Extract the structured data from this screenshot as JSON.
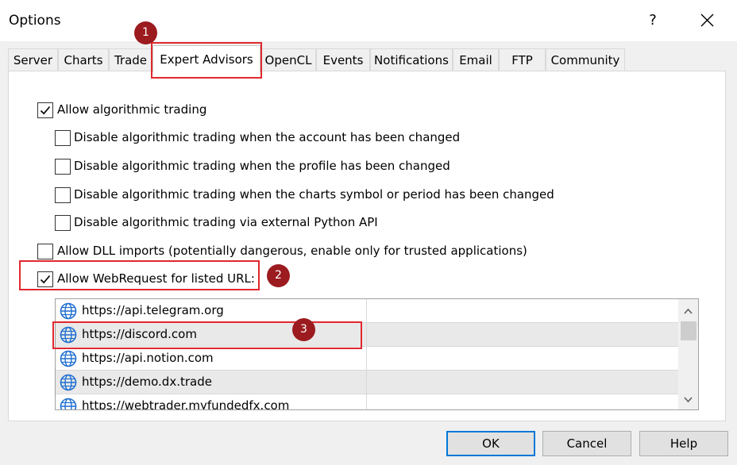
{
  "window": {
    "title": "Options",
    "help_label": "?",
    "close_icon": "close-icon"
  },
  "tabs": [
    {
      "label": "Server"
    },
    {
      "label": "Charts"
    },
    {
      "label": "Trade"
    },
    {
      "label": "Expert Advisors",
      "active": true
    },
    {
      "label": "OpenCL"
    },
    {
      "label": "Events"
    },
    {
      "label": "Notifications"
    },
    {
      "label": "Email"
    },
    {
      "label": "FTP"
    },
    {
      "label": "Community"
    }
  ],
  "options": {
    "allow_algo": {
      "label": "Allow algorithmic trading",
      "checked": true
    },
    "disable_account": {
      "label": "Disable algorithmic trading when the account has been changed",
      "checked": false
    },
    "disable_profile": {
      "label": "Disable algorithmic trading when the profile has been changed",
      "checked": false
    },
    "disable_symbol": {
      "label": "Disable algorithmic trading when the charts symbol or period has been changed",
      "checked": false
    },
    "disable_python": {
      "label": "Disable algorithmic trading via external Python API",
      "checked": false
    },
    "allow_dll": {
      "label": "Allow DLL imports (potentially dangerous, enable only for trusted applications)",
      "checked": false
    },
    "allow_webrequest": {
      "label": "Allow WebRequest for listed URL:",
      "checked": true
    }
  },
  "url_list": [
    {
      "url": "https://api.telegram.org"
    },
    {
      "url": "https://discord.com"
    },
    {
      "url": "https://api.notion.com"
    },
    {
      "url": "https://demo.dx.trade"
    },
    {
      "url": "https://webtrader.myfundedfx.com"
    }
  ],
  "buttons": {
    "ok": "OK",
    "cancel": "Cancel",
    "help": "Help"
  },
  "annotations": {
    "badge_1": "1",
    "badge_2": "2",
    "badge_3": "3"
  },
  "colors": {
    "highlight": "#e0282e",
    "badge": "#9b1b1f",
    "default_button_border": "#0078d7"
  }
}
